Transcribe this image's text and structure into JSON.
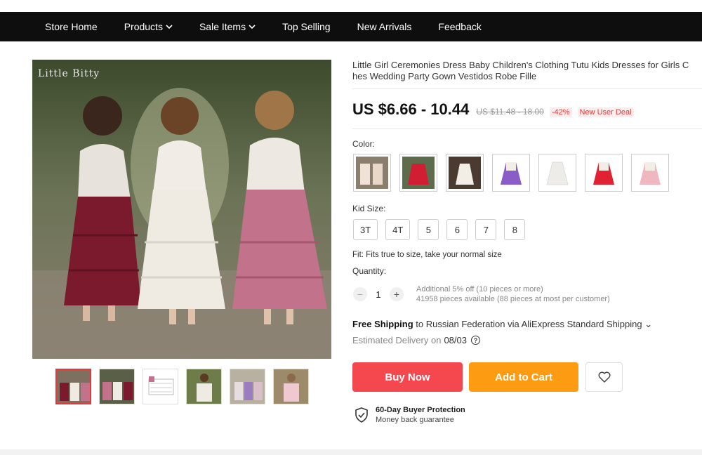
{
  "nav": {
    "items": [
      {
        "label": "Store Home",
        "dropdown": false
      },
      {
        "label": "Products",
        "dropdown": true
      },
      {
        "label": "Sale Items",
        "dropdown": true
      },
      {
        "label": "Top Selling",
        "dropdown": false
      },
      {
        "label": "New Arrivals",
        "dropdown": false
      },
      {
        "label": "Feedback",
        "dropdown": false
      }
    ]
  },
  "gallery": {
    "brand_watermark": "Little Bitty",
    "thumbnail_count": 6,
    "active_thumbnail": 1
  },
  "product": {
    "title_line1": "Little Girl Ceremonies Dress Baby Children's Clothing Tutu Kids Dresses for Girls C",
    "title_line2": "hes Wedding Party Gown Vestidos Robe Fille",
    "price": "US $6.66 - 10.44",
    "original_price": "US $11.48 - 18.00",
    "discount": "-42%",
    "deal": "New User Deal"
  },
  "options": {
    "color_label": "Color:",
    "colors": [
      "pink-white",
      "red",
      "white",
      "purple",
      "white",
      "red-white",
      "pink"
    ],
    "size_label": "Kid Size:",
    "sizes": [
      "3T",
      "4T",
      "5",
      "6",
      "7",
      "8"
    ],
    "fit_text": "Fit: Fits true to size, take your normal size",
    "quantity_label": "Quantity:",
    "quantity_value": "1",
    "quantity_minus": "−",
    "quantity_plus": "+",
    "quantity_info1": "Additional 5% off (10 pieces or more)",
    "quantity_info2": "41958 pieces available (88 pieces at most per customer)"
  },
  "shipping": {
    "free": "Free Shipping",
    "rest": " to Russian Federation via AliExpress Standard Shipping ⌄",
    "delivery_label": "Estimated Delivery on",
    "delivery_date": "08/03",
    "help": "?"
  },
  "actions": {
    "buy_now": "Buy Now",
    "add_to_cart": "Add to Cart"
  },
  "protection": {
    "title": "60-Day Buyer Protection",
    "subtitle": "Money back guarantee"
  },
  "colors": {
    "nav_bg": "#0e0e0e",
    "buy_now": "#f5474e",
    "add_to_cart": "#fd9b12",
    "sale_red": "#e4393c"
  }
}
